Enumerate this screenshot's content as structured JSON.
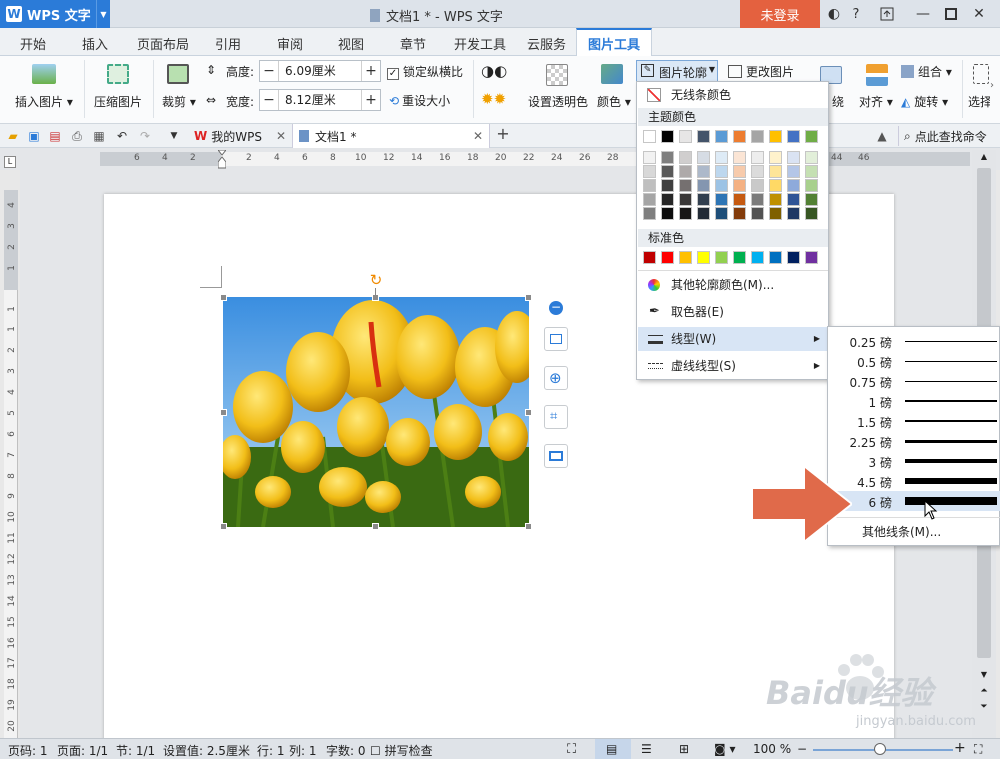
{
  "titlebar": {
    "app_name": "WPS 文字",
    "document_title": "文档1 * - WPS 文字",
    "login": "未登录",
    "help": "?"
  },
  "tabs": [
    "开始",
    "插入",
    "页面布局",
    "引用",
    "审阅",
    "视图",
    "章节",
    "开发工具",
    "云服务",
    "图片工具"
  ],
  "active_tab": "图片工具",
  "ribbon": {
    "insert_picture": "插入图片",
    "compress_picture": "压缩图片",
    "crop": "裁剪",
    "height_label": "高度:",
    "height_value": "6.09厘米",
    "width_label": "宽度:",
    "width_value": "8.12厘米",
    "lock_ratio": "锁定纵横比",
    "reset_size": "重设大小",
    "set_transparent": "设置透明色",
    "color": "颜色",
    "picture_outline": "图片轮廓",
    "change_picture": "更改图片",
    "align_partial": "绕",
    "align": "对齐",
    "group": "组合",
    "rotate": "旋转",
    "select_partial": "选择"
  },
  "quick_access": {
    "my_wps": "我的WPS",
    "doc_tab": "文档1 *",
    "find_command": "点此查找命令"
  },
  "ruler": {
    "h_ticks": [
      "6",
      "4",
      "2",
      "2",
      "4",
      "6",
      "8",
      "10",
      "12",
      "14",
      "16",
      "18",
      "20",
      "22",
      "24",
      "26",
      "28",
      "44",
      "46"
    ],
    "v_ticks": [
      "4",
      "3",
      "2",
      "1",
      "1",
      "1",
      "2",
      "3",
      "4",
      "5",
      "6",
      "7",
      "8",
      "9",
      "10",
      "11",
      "12",
      "13",
      "14",
      "15",
      "16",
      "17",
      "18",
      "19",
      "20",
      "21"
    ]
  },
  "outline_menu": {
    "no_line_color": "无线条颜色",
    "theme_colors_label": "主题颜色",
    "standard_colors_label": "标准色",
    "theme_top": [
      "#ffffff",
      "#000000",
      "#e7e6e6",
      "#44546a",
      "#5b9bd5",
      "#ed7d31",
      "#a5a5a5",
      "#ffc000",
      "#4472c4",
      "#70ad47"
    ],
    "theme_shades": [
      [
        "#f2f2f2",
        "#7f7f7f",
        "#d0cece",
        "#d6dce4",
        "#deebf6",
        "#fbe5d5",
        "#ededed",
        "#fff2cc",
        "#dae3f3",
        "#e2efd9"
      ],
      [
        "#d8d8d8",
        "#595959",
        "#aeaaaa",
        "#adb9ca",
        "#bdd7ee",
        "#f7cbac",
        "#dbdbdb",
        "#fee599",
        "#b4c6e7",
        "#c5e0b3"
      ],
      [
        "#bfbfbf",
        "#3f3f3f",
        "#757070",
        "#8496b0",
        "#9cc3e5",
        "#f4b183",
        "#c9c9c9",
        "#ffd965",
        "#8eaadb",
        "#a8d08d"
      ],
      [
        "#a5a5a5",
        "#262626",
        "#3a3838",
        "#323f4f",
        "#2e75b5",
        "#c55a11",
        "#7b7b7b",
        "#bf9000",
        "#2f5496",
        "#538135"
      ],
      [
        "#7f7f7f",
        "#0c0c0c",
        "#171616",
        "#222a35",
        "#1e4e79",
        "#833c0b",
        "#525252",
        "#7f6000",
        "#1f3864",
        "#375623"
      ]
    ],
    "standard": [
      "#c00000",
      "#ff0000",
      "#ffc000",
      "#ffff00",
      "#92d050",
      "#00b050",
      "#00b0f0",
      "#0070c0",
      "#002060",
      "#7030a0"
    ],
    "more_colors": "其他轮廓颜色(M)...",
    "eyedropper": "取色器(E)",
    "line_style": "线型(W)",
    "dash_style": "虚线线型(S)"
  },
  "line_submenu": {
    "weights": [
      "0.25 磅",
      "0.5 磅",
      "0.75 磅",
      "1 磅",
      "1.5 磅",
      "2.25 磅",
      "3 磅",
      "4.5 磅",
      "6 磅"
    ],
    "selected": "6 磅",
    "more_lines": "其他线条(M)..."
  },
  "statusbar": {
    "page_num": "页码: 1",
    "pages": "页面: 1/1",
    "section": "节: 1/1",
    "setting": "设置值: 2.5厘米",
    "row": "行: 1",
    "col": "列: 1",
    "word_count": "字数: 0",
    "spell_check": "拼写检查",
    "zoom": "100 %"
  },
  "watermark": {
    "brand": "Baidu经验",
    "url": "jingyan.baidu.com"
  },
  "colors": {
    "accent": "#2b7bd8",
    "login": "#e4613f",
    "arrow": "#e06a4a"
  }
}
